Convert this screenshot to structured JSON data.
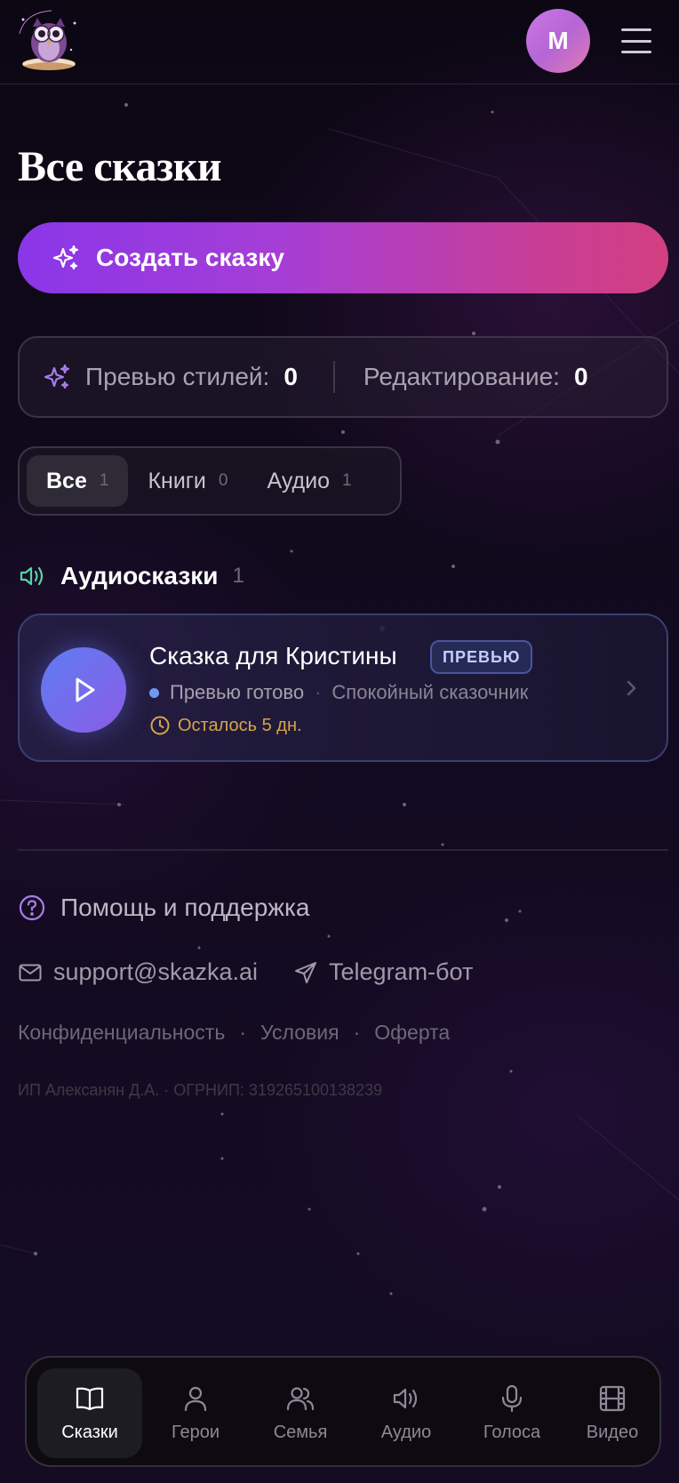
{
  "header": {
    "logo_icon": "owl-logo-icon",
    "avatar_initial": "M",
    "menu_icon": "hamburger-menu-icon"
  },
  "page_title": "Все сказки",
  "create_button": {
    "label": "Создать сказку",
    "icon": "sparkles-icon"
  },
  "stats": {
    "icon": "sparkles-icon",
    "style_previews_label": "Превью стилей:",
    "style_previews_value": "0",
    "editing_label": "Редактирование:",
    "editing_value": "0"
  },
  "filter_tabs": [
    {
      "label": "Все",
      "count": "1",
      "active": true
    },
    {
      "label": "Книги",
      "count": "0",
      "active": false
    },
    {
      "label": "Аудио",
      "count": "1",
      "active": false
    }
  ],
  "audio_section": {
    "icon": "speaker-icon",
    "title": "Аудиосказки",
    "count": "1"
  },
  "story": {
    "title": "Сказка для Кристины",
    "badge": "ПРЕВЬЮ",
    "status": "Превью готово",
    "separator": "·",
    "voice": "Спокойный сказочник",
    "time_left": "Осталось 5 дн.",
    "status_color": "#6f98f5",
    "time_color": "#d9a44a"
  },
  "footer": {
    "help_label": "Помощь и поддержка",
    "email": "support@skazka.ai",
    "telegram": "Telegram-бот",
    "links": [
      "Конфиденциальность",
      "Условия",
      "Оферта"
    ],
    "link_separator": "·",
    "legal_entity": "ИП Алексанян Д.А. · ОГРНИП: 319265100138239"
  },
  "bottom_nav": [
    {
      "label": "Сказки",
      "icon": "book-icon",
      "active": true
    },
    {
      "label": "Герои",
      "icon": "user-icon",
      "active": false
    },
    {
      "label": "Семья",
      "icon": "users-icon",
      "active": false
    },
    {
      "label": "Аудио",
      "icon": "speaker-icon",
      "active": false
    },
    {
      "label": "Голоса",
      "icon": "microphone-icon",
      "active": false
    },
    {
      "label": "Видео",
      "icon": "film-icon",
      "active": false
    }
  ],
  "colors": {
    "accent_start": "#8a36e8",
    "accent_end": "#d23f80",
    "background": "#0b0612"
  }
}
